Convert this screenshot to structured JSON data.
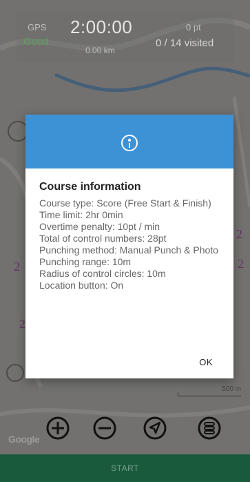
{
  "status": {
    "gps_label": "GPS",
    "gps_value": "Good",
    "timer": "2:00:00",
    "distance": "0.00 km",
    "points": "0 pt",
    "visited": "0 / 14 visited"
  },
  "dialog": {
    "title": "Course information",
    "lines": [
      "Course type: Score (Free Start & Finish)",
      "Time limit: 2hr 0min",
      "Overtime penalty: 10pt / min",
      "Total of control numbers: 28pt",
      "Punching method: Manual Punch & Photo",
      "Punching range: 10m",
      "Radius of control circles: 10m",
      "Location button: On"
    ],
    "ok_label": "OK"
  },
  "map": {
    "scale_label": "500 m",
    "attribution": "Google"
  },
  "controls": {
    "zoom_in_icon": "plus-circle-icon",
    "zoom_out_icon": "minus-circle-icon",
    "locate_icon": "navigation-arrow-icon",
    "menu_icon": "list-circle-icon"
  },
  "start_label": "START",
  "colors": {
    "header": "#3d92d6",
    "gps_good": "#5aa05a",
    "start_bar": "#1a5a3c"
  }
}
